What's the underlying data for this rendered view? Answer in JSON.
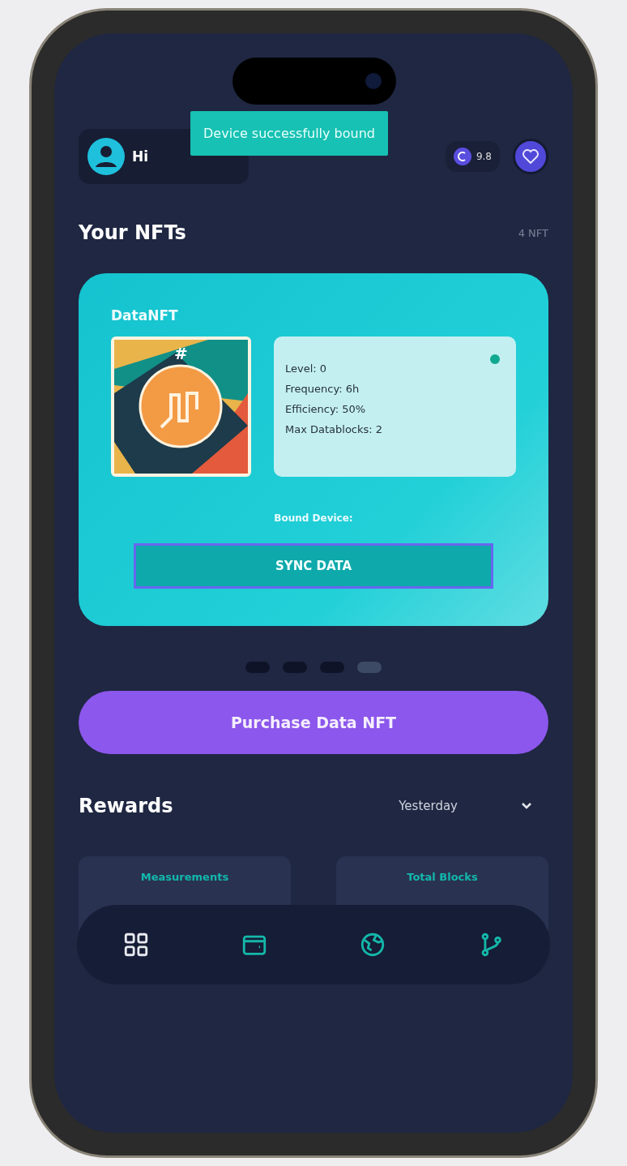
{
  "toast": {
    "message": "Device successfully bound"
  },
  "header": {
    "greeting": "Hi",
    "balance": "9.8"
  },
  "nfts": {
    "title": "Your NFTs",
    "count": "4 NFT"
  },
  "card": {
    "title": "DataNFT",
    "image_tag": "#",
    "stats": [
      "Level: 0",
      "Frequency: 6h",
      "Efficiency: 50%",
      "Max Datablocks: 2"
    ],
    "bound_device": "Bound Device:",
    "sync_button": "SYNC DATA"
  },
  "pager": [
    {
      "selected": false
    },
    {
      "selected": false
    },
    {
      "selected": false
    },
    {
      "selected": true
    }
  ],
  "purchase_button": "Purchase Data NFT",
  "rewards": {
    "title": "Rewards",
    "period": "Yesterday",
    "tiles": [
      "Measurements",
      "Total Blocks"
    ]
  },
  "nav": [
    {
      "selected": true
    },
    {
      "selected": false
    },
    {
      "selected": false
    },
    {
      "selected": false
    }
  ]
}
